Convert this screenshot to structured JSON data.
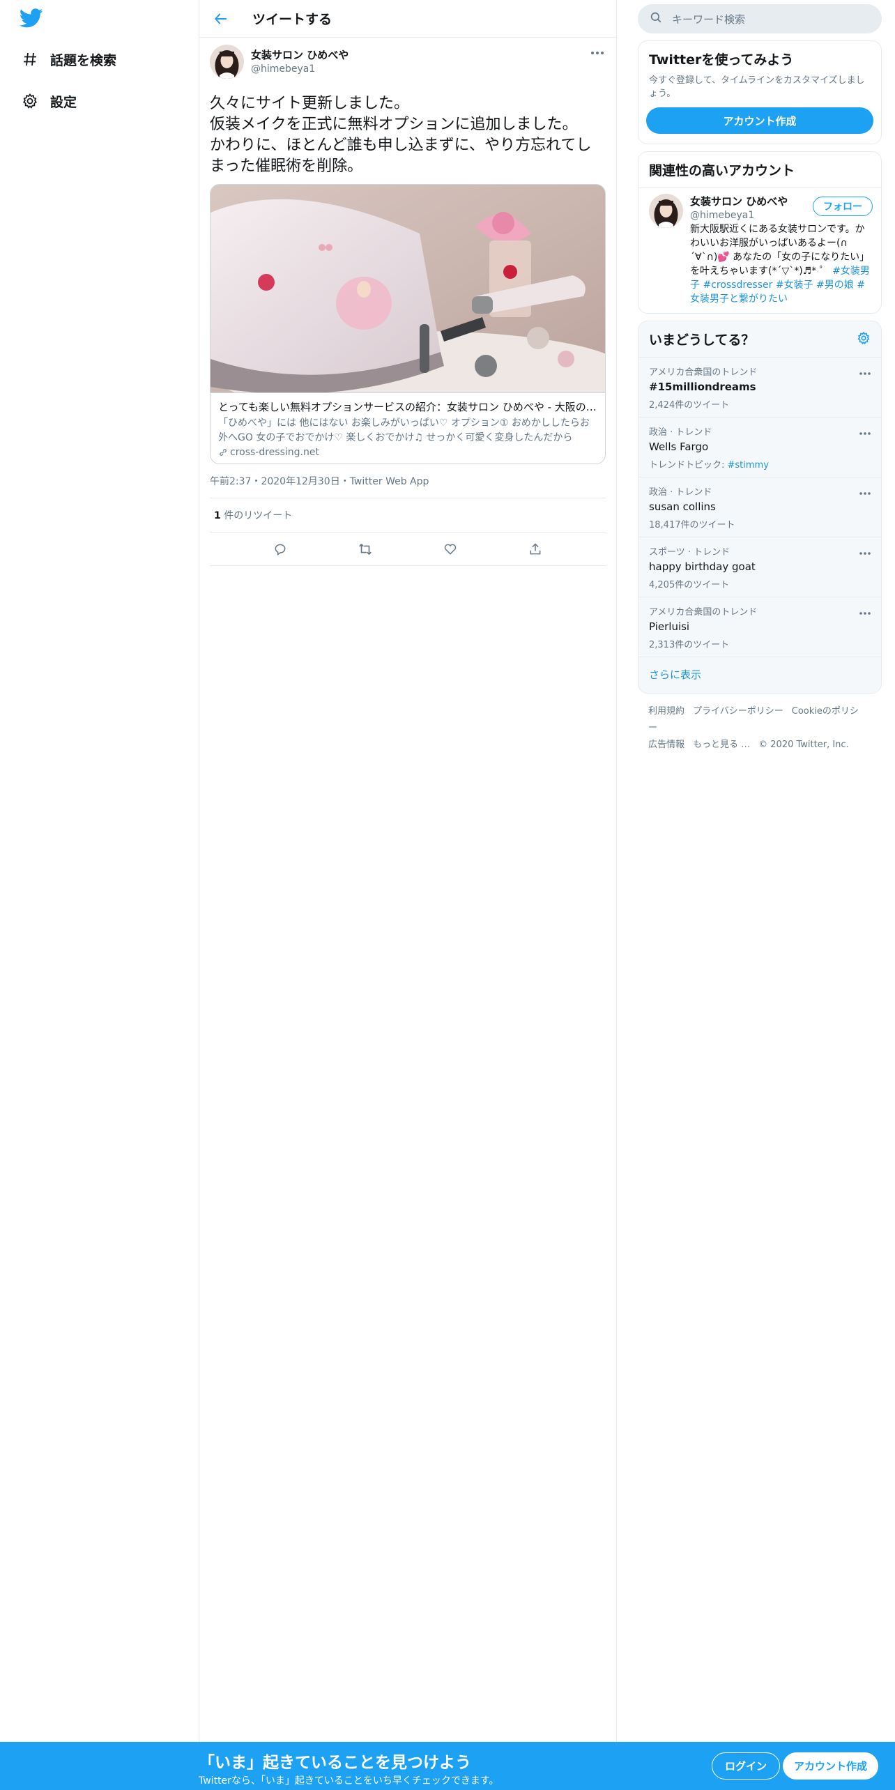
{
  "nav": {
    "logo_icon": "twitter-bird-icon",
    "items": [
      {
        "icon": "hashtag-icon",
        "label": "話題を検索"
      },
      {
        "icon": "gear-icon",
        "label": "設定"
      }
    ]
  },
  "header": {
    "back_icon": "arrow-left-icon",
    "title": "ツイートする"
  },
  "tweet": {
    "author_name": "女装サロン ひめべや",
    "author_handle": "@himebeya1",
    "text": "久々にサイト更新しました。\n仮装メイクを正式に無料オプションに追加しました。\nかわりに、ほとんど誰も申し込まずに、やり方忘れてしまった催眠術を削除。",
    "card": {
      "title": "とっても楽しい無料オプションサービスの紹介：女装サロン ひめべや - 大阪の女装サロン",
      "description": "「ひめべや」には 他にはない お楽しみがいっぱい♡ オプション① おめかししたらお外へGO 女の子でおでかけ♡ 楽しくおでかけ♫ せっかく可愛く変身したんだから",
      "domain": "cross-dressing.net"
    },
    "meta": "午前2:37・2020年12月30日・Twitter Web App",
    "retweet_count": "1",
    "retweet_label": " 件のリツイート"
  },
  "search": {
    "placeholder": "キーワード検索"
  },
  "signup_box": {
    "title": "Twitterを使ってみよう",
    "description": "今すぐ登録して、タイムラインをカスタマイズしましょう。",
    "button": "アカウント作成"
  },
  "related": {
    "title": "関連性の高いアカウント",
    "name": "女装サロン ひめべや",
    "handle": "@himebeya1",
    "follow": "フォロー",
    "bio": "新大阪駅近くにある女装サロンです。かわいいお洋服がいっぱいあるよー(∩ ˊ∀ˋ∩)💕 あなたの「女の子になりたい」を叶えちゃいます(*´▽`*)♬* ゜",
    "tags": "#女装男子 #crossdresser #女装子 #男の娘 #女装男子と繋がりたい"
  },
  "trends": {
    "title": "いまどうしてる？",
    "items": [
      {
        "context": "アメリカ合衆国のトレンド",
        "name": "#15milliondreams",
        "count": "2,424件のツイート"
      },
      {
        "context": "政治 · トレンド",
        "name": "Wells Fargo",
        "count_prefix": "トレンドトピック: ",
        "count_link": "#stimmy"
      },
      {
        "context": "政治 · トレンド",
        "name": "susan collins",
        "count": "18,417件のツイート"
      },
      {
        "context": "スポーツ · トレンド",
        "name": "happy birthday goat",
        "count": "4,205件のツイート"
      },
      {
        "context": "アメリカ合衆国のトレンド",
        "name": "Pierluisi",
        "count": "2,313件のツイート"
      }
    ],
    "show_more": "さらに表示"
  },
  "footer": {
    "links": [
      "利用規約",
      "プライバシーポリシー",
      "Cookieのポリシー",
      "広告情報",
      "もっと見る …"
    ],
    "copyright": "© 2020 Twitter, Inc."
  },
  "bottom_bar": {
    "title": "「いま」起きていることを見つけよう",
    "subtitle": "Twitterなら、「いま」起きていることをいち早くチェックできます。",
    "login": "ログイン",
    "signup": "アカウント作成"
  },
  "colors": {
    "accent": "#1da1f2",
    "link": "#1b95e0",
    "muted": "#657786",
    "border": "#e6ecf0"
  }
}
